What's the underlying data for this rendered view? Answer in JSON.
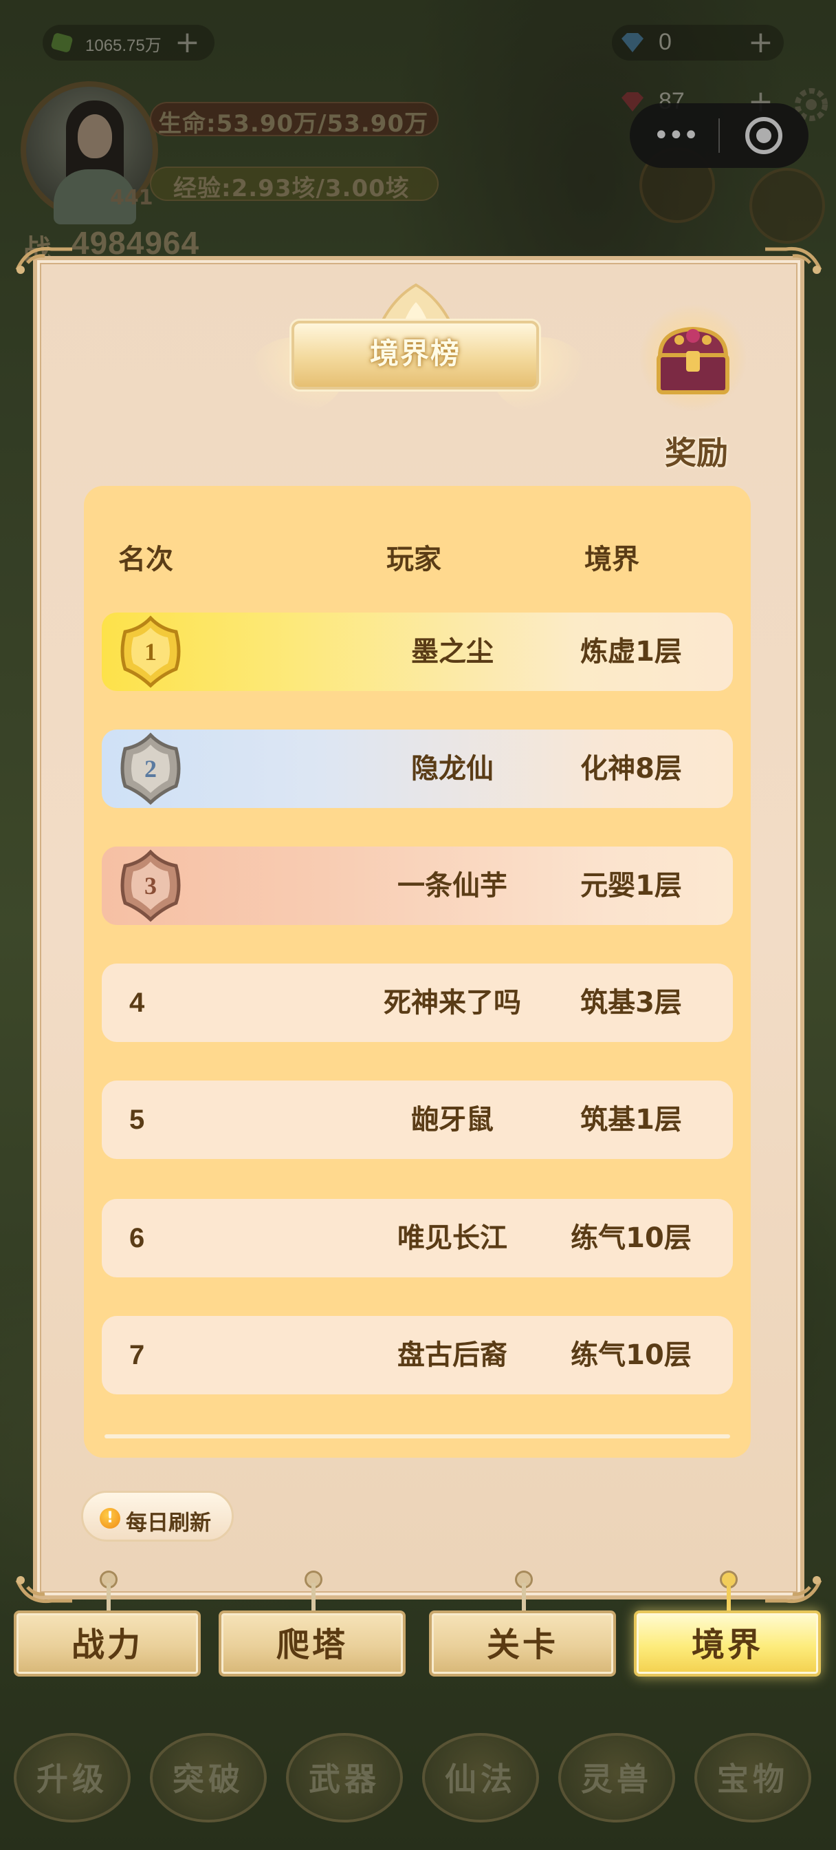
{
  "hud": {
    "gold_amount": "1065.75万",
    "gold_plus": "+",
    "diamond_amount": "0",
    "diamond_plus": "+",
    "gem_amount": "87",
    "gem_plus": "+",
    "hp_text": "生命:53.90万/53.90万",
    "exp_text": "经验:2.93垓/3.00垓",
    "level": "441",
    "power_prefix": "战",
    "power_value": "4984964"
  },
  "panel": {
    "title": "境界榜",
    "reward_label": "奖励",
    "columns": {
      "rank": "名次",
      "player": "玩家",
      "realm": "境界"
    },
    "rows": [
      {
        "rank": "1",
        "player": "墨之尘",
        "realm": "炼虚1层",
        "tier": "gold"
      },
      {
        "rank": "2",
        "player": "隐龙仙",
        "realm": "化神8层",
        "tier": "silver"
      },
      {
        "rank": "3",
        "player": "一条仙芋",
        "realm": "元婴1层",
        "tier": "bronze"
      },
      {
        "rank": "4",
        "player": "死神来了吗",
        "realm": "筑基3层",
        "tier": "normal"
      },
      {
        "rank": "5",
        "player": "龅牙鼠",
        "realm": "筑基1层",
        "tier": "normal"
      },
      {
        "rank": "6",
        "player": "唯见长江",
        "realm": "练气10层",
        "tier": "normal"
      },
      {
        "rank": "7",
        "player": "盘古后裔",
        "realm": "练气10层",
        "tier": "normal"
      }
    ],
    "daily_refresh": "每日刷新",
    "daily_icon_glyph": "!"
  },
  "tabs": [
    {
      "label": "战力",
      "active": false
    },
    {
      "label": "爬塔",
      "active": false
    },
    {
      "label": "关卡",
      "active": false
    },
    {
      "label": "境界",
      "active": true
    }
  ],
  "bottom_nav": [
    "升级",
    "突破",
    "武器",
    "仙法",
    "灵兽",
    "宝物"
  ],
  "colors": {
    "board": "#ffd98e",
    "row": "#fce7d0",
    "text_brown": "#5a3c16",
    "active_tab": "#fdec7c"
  },
  "icons": {
    "gold": "gold-ingot-icon",
    "diamond": "diamond-icon",
    "gem": "ruby-icon",
    "settings": "gear-icon",
    "chest": "treasure-chest-icon",
    "medal_1": "gold-medal-icon",
    "medal_2": "silver-medal-icon",
    "medal_3": "bronze-medal-icon"
  }
}
